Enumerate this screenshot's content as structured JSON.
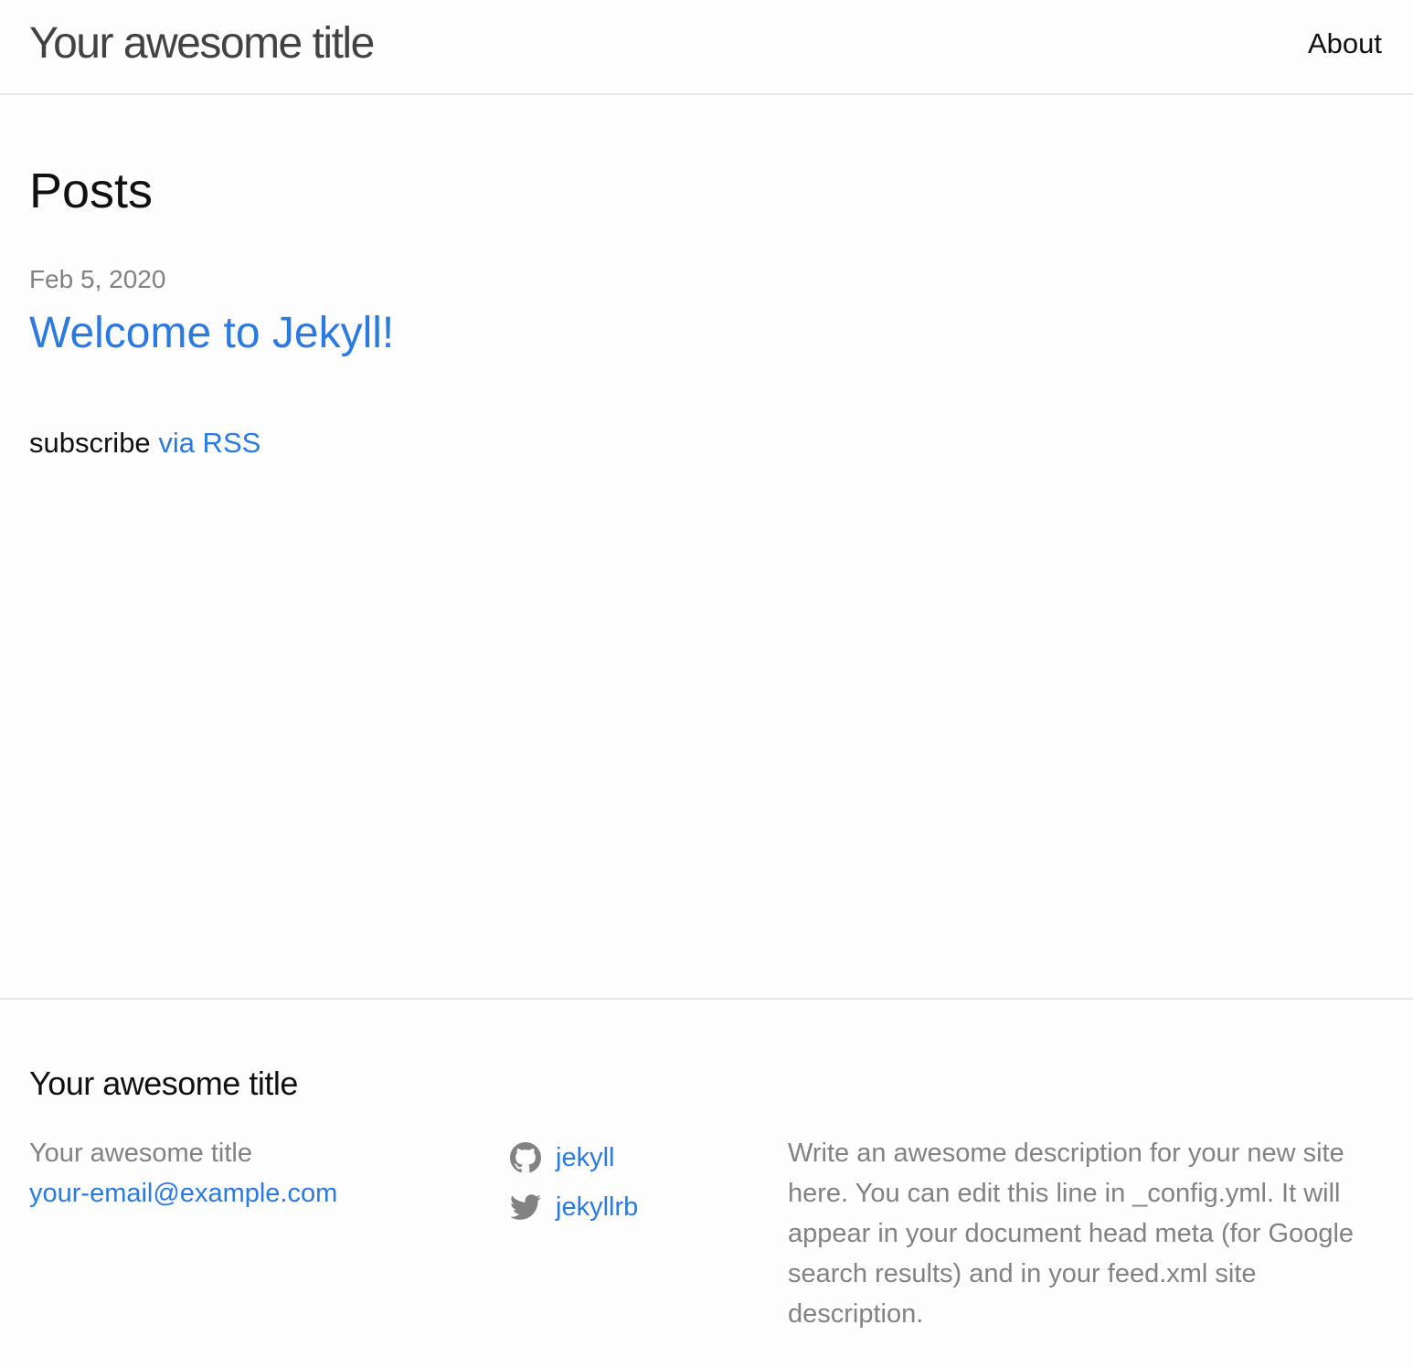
{
  "header": {
    "site_title": "Your awesome title",
    "nav": [
      {
        "label": "About"
      }
    ]
  },
  "main": {
    "heading": "Posts",
    "posts": [
      {
        "date": "Feb 5, 2020",
        "title": "Welcome to Jekyll!"
      }
    ],
    "rss": {
      "prefix": "subscribe",
      "link_label": "via RSS"
    }
  },
  "footer": {
    "heading": "Your awesome title",
    "col1": {
      "name": "Your awesome title",
      "email": "your-email@example.com"
    },
    "social": [
      {
        "icon": "github-icon",
        "label": "jekyll"
      },
      {
        "icon": "twitter-icon",
        "label": "jekyllrb"
      }
    ],
    "description": "Write an awesome description for your new site here. You can edit this line in _config.yml. It will appear in your document head meta (for Google search results) and in your feed.xml site description."
  },
  "colors": {
    "background": "#fdfdfd",
    "text": "#111111",
    "muted": "#828282",
    "link": "#2a7ae2",
    "border": "#e8e8e8",
    "title": "#424242"
  }
}
